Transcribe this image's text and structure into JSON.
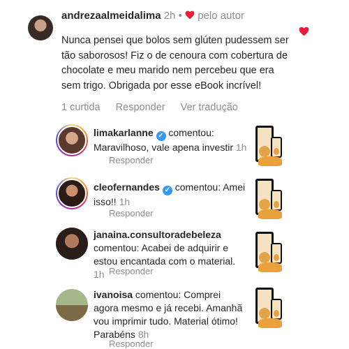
{
  "main_comment": {
    "username": "andrezaalmeidalima",
    "time": "2h",
    "separator": "•",
    "author_label": "pelo autor",
    "text": "Nunca pensei que bolos sem glúten pudessem ser tão saborosos! Fiz o de cenoura com cobertura de chocolate e meu marido nem percebeu que era sem trigo. Obrigada por esse eBook incrível!",
    "likes": "1 curtida",
    "reply_label": "Responder",
    "translate_label": "Ver tradução"
  },
  "replies": [
    {
      "username": "limakarlanne",
      "verified": true,
      "text": "comentou: Maravilhoso, vale apena investir",
      "time": "1h",
      "reply_label": "Responder"
    },
    {
      "username": "cleofernandes",
      "verified": true,
      "text": "comentou: Amei isso!!",
      "time": "1h",
      "reply_label": "Responder"
    },
    {
      "username": "janaina.consultoradebeleza",
      "verified": false,
      "text": "comentou: Acabei de adquirir e estou encantada com o material.",
      "time": "1h",
      "reply_label": "Responder"
    },
    {
      "username": "ivanoisa",
      "verified": false,
      "text": "comentou: Comprei agora mesmo e já recebi. Amanhã vou imprimir tudo. Material ótimo! Parabéns",
      "time": "8h",
      "reply_label": "Responder"
    }
  ],
  "colors": {
    "heart": "#ed1c3a",
    "muted": "#8e8e8e",
    "verified": "#3897f0"
  },
  "icons": {
    "like": "heart-icon",
    "verified": "verified-badge-icon"
  }
}
